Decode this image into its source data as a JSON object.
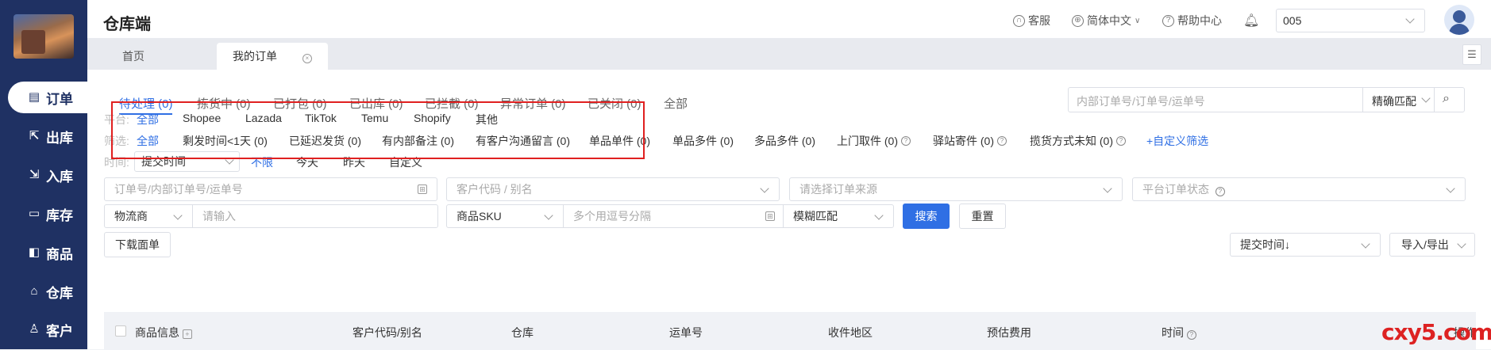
{
  "app": {
    "title": "仓库端"
  },
  "topbar": {
    "support": "客服",
    "language": "简体中文",
    "help": "帮助中心",
    "warehouse_value": "005"
  },
  "sidebar": {
    "items": [
      {
        "label": "订单",
        "icon": "orders-icon"
      },
      {
        "label": "出库",
        "icon": "outbound-icon"
      },
      {
        "label": "入库",
        "icon": "inbound-icon"
      },
      {
        "label": "库存",
        "icon": "inventory-icon"
      },
      {
        "label": "商品",
        "icon": "products-icon"
      },
      {
        "label": "仓库",
        "icon": "warehouse-icon"
      },
      {
        "label": "客户",
        "icon": "customer-icon"
      }
    ]
  },
  "page_tabs": [
    {
      "label": "首页"
    },
    {
      "label": "我的订单"
    }
  ],
  "status_tabs": [
    {
      "label": "待处理 (0)"
    },
    {
      "label": "拣货中 (0)"
    },
    {
      "label": "已打包 (0)"
    },
    {
      "label": "已出库 (0)"
    },
    {
      "label": "已拦截 (0)"
    },
    {
      "label": "异常订单 (0)"
    },
    {
      "label": "已关闭 (0)"
    },
    {
      "label": "全部"
    }
  ],
  "top_search": {
    "placeholder": "内部订单号/订单号/运单号",
    "match_mode": "精确匹配"
  },
  "filters": {
    "platform_label": "平台:",
    "platforms": [
      "全部",
      "Shopee",
      "Lazada",
      "TikTok",
      "Temu",
      "Shopify",
      "其他"
    ],
    "screen_label": "筛选:",
    "screens": [
      "全部",
      "剩发时间<1天 (0)",
      "已延迟发货 (0)",
      "有内部备注 (0)",
      "有客户沟通留言 (0)",
      "单品单件 (0)",
      "单品多件 (0)",
      "多品多件 (0)",
      "上门取件 (0)",
      "驿站寄件 (0)",
      "揽货方式未知 (0)",
      "+自定义筛选"
    ],
    "time_label": "时间:",
    "time_field": "提交时间",
    "time_options": [
      "不限",
      "今天",
      "昨天",
      "自定义"
    ]
  },
  "form": {
    "order_no_placeholder": "订单号/内部订单号/运单号",
    "customer_placeholder": "客户代码 / 别名",
    "source_placeholder": "请选择订单来源",
    "platform_status_placeholder": "平台订单状态",
    "logistics_label": "物流商",
    "logistics_placeholder": "请输入",
    "sku_label": "商品SKU",
    "tracking_placeholder": "多个用逗号分隔",
    "fuzzy_match": "模糊匹配",
    "search_button": "搜索",
    "reset_button": "重置",
    "download_button": "下载面单",
    "sort_value": "提交时间↓",
    "import_export": "导入/导出"
  },
  "table": {
    "headers": [
      "商品信息",
      "客户代码/别名",
      "仓库",
      "运单号",
      "收件地区",
      "预估费用",
      "时间",
      "操作"
    ]
  },
  "watermark": "cxy5.com",
  "colors": {
    "sidebar": "#1f3163",
    "accent": "#2f6fe4",
    "highlight_box": "#e02020"
  }
}
